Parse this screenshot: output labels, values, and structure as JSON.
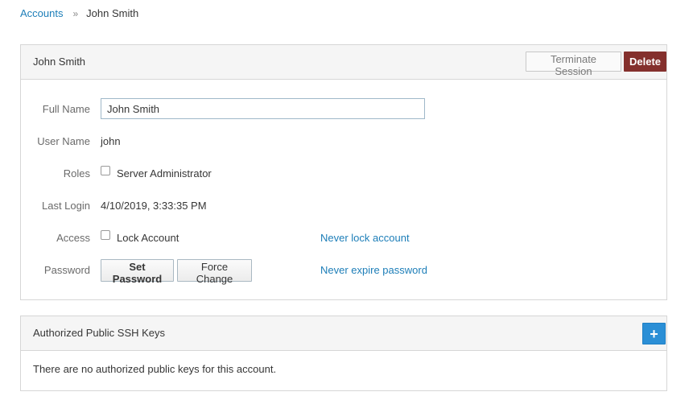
{
  "breadcrumb": {
    "root": "Accounts",
    "separator": "»",
    "current": "John Smith"
  },
  "account_panel": {
    "title": "John Smith",
    "terminate_label": "Terminate Session",
    "delete_label": "Delete",
    "fields": {
      "full_name_label": "Full Name",
      "full_name_value": "John Smith",
      "user_name_label": "User Name",
      "user_name_value": "john",
      "roles_label": "Roles",
      "roles_option": "Server Administrator",
      "last_login_label": "Last Login",
      "last_login_value": "4/10/2019, 3:33:35 PM",
      "access_label": "Access",
      "lock_option": "Lock Account",
      "lock_link": "Never lock account",
      "password_label": "Password",
      "set_password_label": "Set Password",
      "force_change_label": "Force Change",
      "expire_link": "Never expire password"
    }
  },
  "ssh_panel": {
    "title": "Authorized Public SSH Keys",
    "add_icon": "+",
    "empty_message": "There are no authorized public keys for this account."
  },
  "colors": {
    "link": "#1d7eb8",
    "danger": "#84302d",
    "primary": "#2b8fd6"
  }
}
